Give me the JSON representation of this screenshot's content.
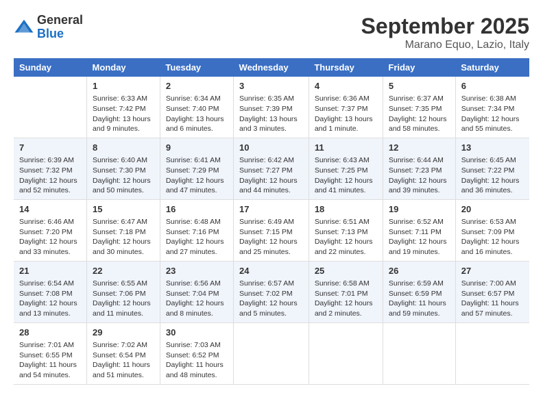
{
  "header": {
    "logo_general": "General",
    "logo_blue": "Blue",
    "month_title": "September 2025",
    "location": "Marano Equo, Lazio, Italy"
  },
  "weekdays": [
    "Sunday",
    "Monday",
    "Tuesday",
    "Wednesday",
    "Thursday",
    "Friday",
    "Saturday"
  ],
  "weeks": [
    [
      {
        "day": "",
        "data": ""
      },
      {
        "day": "1",
        "data": "Sunrise: 6:33 AM\nSunset: 7:42 PM\nDaylight: 13 hours\nand 9 minutes."
      },
      {
        "day": "2",
        "data": "Sunrise: 6:34 AM\nSunset: 7:40 PM\nDaylight: 13 hours\nand 6 minutes."
      },
      {
        "day": "3",
        "data": "Sunrise: 6:35 AM\nSunset: 7:39 PM\nDaylight: 13 hours\nand 3 minutes."
      },
      {
        "day": "4",
        "data": "Sunrise: 6:36 AM\nSunset: 7:37 PM\nDaylight: 13 hours\nand 1 minute."
      },
      {
        "day": "5",
        "data": "Sunrise: 6:37 AM\nSunset: 7:35 PM\nDaylight: 12 hours\nand 58 minutes."
      },
      {
        "day": "6",
        "data": "Sunrise: 6:38 AM\nSunset: 7:34 PM\nDaylight: 12 hours\nand 55 minutes."
      }
    ],
    [
      {
        "day": "7",
        "data": "Sunrise: 6:39 AM\nSunset: 7:32 PM\nDaylight: 12 hours\nand 52 minutes."
      },
      {
        "day": "8",
        "data": "Sunrise: 6:40 AM\nSunset: 7:30 PM\nDaylight: 12 hours\nand 50 minutes."
      },
      {
        "day": "9",
        "data": "Sunrise: 6:41 AM\nSunset: 7:29 PM\nDaylight: 12 hours\nand 47 minutes."
      },
      {
        "day": "10",
        "data": "Sunrise: 6:42 AM\nSunset: 7:27 PM\nDaylight: 12 hours\nand 44 minutes."
      },
      {
        "day": "11",
        "data": "Sunrise: 6:43 AM\nSunset: 7:25 PM\nDaylight: 12 hours\nand 41 minutes."
      },
      {
        "day": "12",
        "data": "Sunrise: 6:44 AM\nSunset: 7:23 PM\nDaylight: 12 hours\nand 39 minutes."
      },
      {
        "day": "13",
        "data": "Sunrise: 6:45 AM\nSunset: 7:22 PM\nDaylight: 12 hours\nand 36 minutes."
      }
    ],
    [
      {
        "day": "14",
        "data": "Sunrise: 6:46 AM\nSunset: 7:20 PM\nDaylight: 12 hours\nand 33 minutes."
      },
      {
        "day": "15",
        "data": "Sunrise: 6:47 AM\nSunset: 7:18 PM\nDaylight: 12 hours\nand 30 minutes."
      },
      {
        "day": "16",
        "data": "Sunrise: 6:48 AM\nSunset: 7:16 PM\nDaylight: 12 hours\nand 27 minutes."
      },
      {
        "day": "17",
        "data": "Sunrise: 6:49 AM\nSunset: 7:15 PM\nDaylight: 12 hours\nand 25 minutes."
      },
      {
        "day": "18",
        "data": "Sunrise: 6:51 AM\nSunset: 7:13 PM\nDaylight: 12 hours\nand 22 minutes."
      },
      {
        "day": "19",
        "data": "Sunrise: 6:52 AM\nSunset: 7:11 PM\nDaylight: 12 hours\nand 19 minutes."
      },
      {
        "day": "20",
        "data": "Sunrise: 6:53 AM\nSunset: 7:09 PM\nDaylight: 12 hours\nand 16 minutes."
      }
    ],
    [
      {
        "day": "21",
        "data": "Sunrise: 6:54 AM\nSunset: 7:08 PM\nDaylight: 12 hours\nand 13 minutes."
      },
      {
        "day": "22",
        "data": "Sunrise: 6:55 AM\nSunset: 7:06 PM\nDaylight: 12 hours\nand 11 minutes."
      },
      {
        "day": "23",
        "data": "Sunrise: 6:56 AM\nSunset: 7:04 PM\nDaylight: 12 hours\nand 8 minutes."
      },
      {
        "day": "24",
        "data": "Sunrise: 6:57 AM\nSunset: 7:02 PM\nDaylight: 12 hours\nand 5 minutes."
      },
      {
        "day": "25",
        "data": "Sunrise: 6:58 AM\nSunset: 7:01 PM\nDaylight: 12 hours\nand 2 minutes."
      },
      {
        "day": "26",
        "data": "Sunrise: 6:59 AM\nSunset: 6:59 PM\nDaylight: 11 hours\nand 59 minutes."
      },
      {
        "day": "27",
        "data": "Sunrise: 7:00 AM\nSunset: 6:57 PM\nDaylight: 11 hours\nand 57 minutes."
      }
    ],
    [
      {
        "day": "28",
        "data": "Sunrise: 7:01 AM\nSunset: 6:55 PM\nDaylight: 11 hours\nand 54 minutes."
      },
      {
        "day": "29",
        "data": "Sunrise: 7:02 AM\nSunset: 6:54 PM\nDaylight: 11 hours\nand 51 minutes."
      },
      {
        "day": "30",
        "data": "Sunrise: 7:03 AM\nSunset: 6:52 PM\nDaylight: 11 hours\nand 48 minutes."
      },
      {
        "day": "",
        "data": ""
      },
      {
        "day": "",
        "data": ""
      },
      {
        "day": "",
        "data": ""
      },
      {
        "day": "",
        "data": ""
      }
    ]
  ]
}
